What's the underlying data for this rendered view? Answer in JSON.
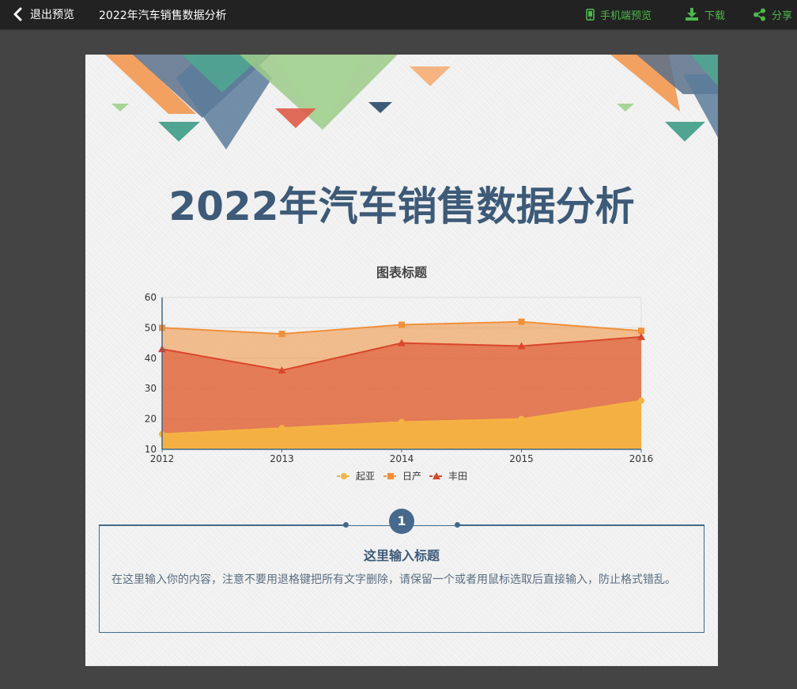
{
  "topbar": {
    "back_label": "退出预览",
    "doc_title": "2022年汽车销售数据分析",
    "mobile_preview_label": "手机端预览",
    "download_label": "下载",
    "share_label": "分享",
    "accent_color": "#4cb84a"
  },
  "page": {
    "main_title": "2022年汽车销售数据分析",
    "section": {
      "number": "1",
      "title": "这里输入标题",
      "body": "在这里输入你的内容，注意不要用退格键把所有文字删除，请保留一个或者用鼠标选取后直接输入，防止格式错乱。"
    }
  },
  "chart_data": {
    "type": "area",
    "title": "图表标题",
    "categories": [
      "2012",
      "2013",
      "2014",
      "2015",
      "2016"
    ],
    "ylim": [
      10,
      60
    ],
    "yticks": [
      10,
      20,
      30,
      40,
      50,
      60
    ],
    "grid": "horizontal",
    "legend_position": "bottom",
    "series": [
      {
        "name": "起亚",
        "values": [
          15,
          17,
          19,
          20,
          26
        ],
        "color": "#f5b342",
        "marker": "circle"
      },
      {
        "name": "日产",
        "values": [
          50,
          48,
          51,
          52,
          49
        ],
        "color": "#f0903a",
        "marker": "square"
      },
      {
        "name": "丰田",
        "values": [
          43,
          36,
          45,
          44,
          47
        ],
        "color": "#d9472b",
        "marker": "triangle"
      }
    ]
  }
}
